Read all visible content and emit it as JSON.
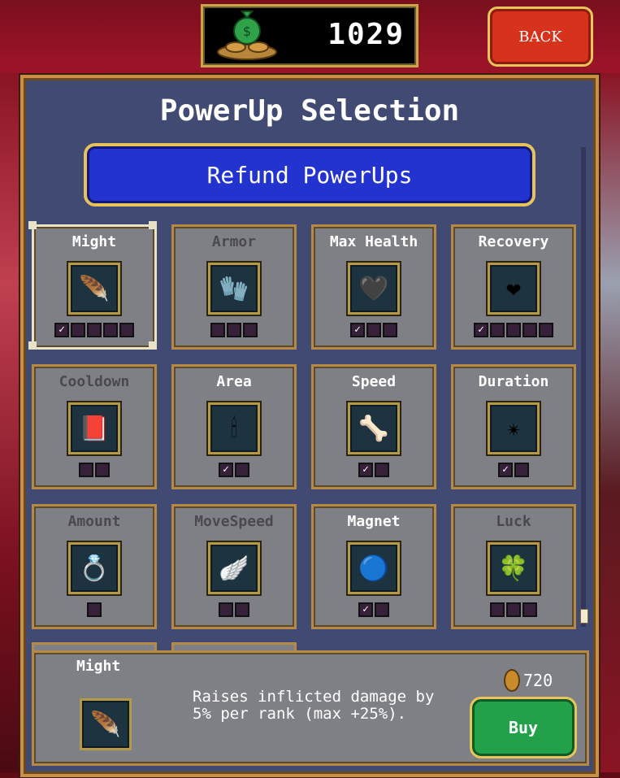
{
  "header": {
    "coins": "1029",
    "back_label": "BACK",
    "coin_icon": "money-bag-icon"
  },
  "panel": {
    "title": "PowerUp Selection",
    "refund_label": "Refund PowerUps"
  },
  "powerups": [
    {
      "name": "Might",
      "icon": "feather-icon",
      "glyph": "🪶",
      "available": true,
      "ranks": 5,
      "owned": 1,
      "selected": true
    },
    {
      "name": "Armor",
      "icon": "gauntlet-icon",
      "glyph": "🧤",
      "available": false,
      "ranks": 3,
      "owned": 0
    },
    {
      "name": "Max Health",
      "icon": "heart-outline-icon",
      "glyph": "🖤",
      "available": true,
      "ranks": 3,
      "owned": 1
    },
    {
      "name": "Recovery",
      "icon": "heart-icon",
      "glyph": "❤",
      "available": true,
      "ranks": 5,
      "owned": 1
    },
    {
      "name": "Cooldown",
      "icon": "book-icon",
      "glyph": "📕",
      "available": false,
      "ranks": 2,
      "owned": 0
    },
    {
      "name": "Area",
      "icon": "candelabra-icon",
      "glyph": "🕯",
      "available": true,
      "ranks": 2,
      "owned": 1
    },
    {
      "name": "Speed",
      "icon": "bracer-icon",
      "glyph": "🦴",
      "available": true,
      "ranks": 2,
      "owned": 1
    },
    {
      "name": "Duration",
      "icon": "spellbinder-icon",
      "glyph": "✴",
      "available": true,
      "ranks": 2,
      "owned": 1
    },
    {
      "name": "Amount",
      "icon": "ring-icon",
      "glyph": "💍",
      "available": false,
      "ranks": 1,
      "owned": 0
    },
    {
      "name": "MoveSpeed",
      "icon": "wing-icon",
      "glyph": "🪽",
      "available": false,
      "ranks": 2,
      "owned": 0
    },
    {
      "name": "Magnet",
      "icon": "orb-icon",
      "glyph": "🔵",
      "available": true,
      "ranks": 2,
      "owned": 1
    },
    {
      "name": "Luck",
      "icon": "clover-icon",
      "glyph": "🍀",
      "available": false,
      "ranks": 3,
      "owned": 0
    }
  ],
  "detail": {
    "name": "Might",
    "icon": "feather-icon",
    "glyph": "🪶",
    "description": "Raises inflicted damage by 5% per rank (max +25%).",
    "price": "720",
    "buy_label": "Buy"
  },
  "colors": {
    "panel": "#414a72",
    "card": "#7f8086",
    "gold_border": "#b58a48",
    "refund_blue": "#2233d0",
    "buy_green": "#22a04a",
    "back_red": "#d7321c"
  }
}
